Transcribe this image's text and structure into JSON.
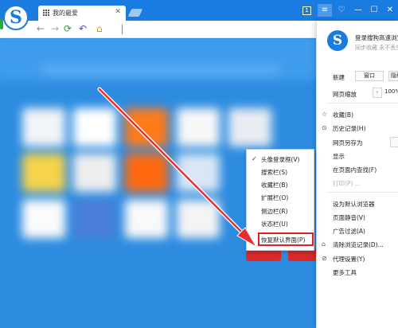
{
  "browser": {
    "tab_title": "我的最爱",
    "tab_close": "✕",
    "badge_count": "1",
    "window_controls": {
      "menu": "≡",
      "skin": "♡",
      "minimize": "—",
      "maximize": "☐",
      "close": "✕"
    },
    "logo_letter": "S"
  },
  "toolbar": {
    "back": "←",
    "forward": "→",
    "refresh": "⟳",
    "undo": "↶",
    "home": "⌂"
  },
  "panel": {
    "logo_letter": "S",
    "login_text": "登录搜狗高速浏览器",
    "sync_text": "同步收藏 永不丢失",
    "new_label": "新建",
    "new_window": "窗口",
    "new_incognito": "隐私窗口",
    "zoom_label": "网页缩放",
    "zoom_minus": "-",
    "zoom_value": "100%",
    "items_top": [
      {
        "label": "收藏(B)",
        "icon": "☆"
      },
      {
        "label": "历史记录(H)",
        "icon": "⊙"
      },
      {
        "label": "网页另存为",
        "icon": ""
      },
      {
        "label": "显示",
        "icon": ""
      },
      {
        "label": "在页面内查找(F)",
        "icon": ""
      },
      {
        "label": "打印(P) ...",
        "icon": ""
      }
    ],
    "items_bottom": [
      {
        "label": "设为默认浏览器",
        "icon": ""
      },
      {
        "label": "页面静音(V)",
        "icon": ""
      },
      {
        "label": "广告过滤(A)",
        "icon": ""
      },
      {
        "label": "清除浏览记录(D)...",
        "icon": "⌂"
      },
      {
        "label": "代理设置(Y)",
        "icon": "⊘"
      },
      {
        "label": "更多工具",
        "icon": ""
      }
    ]
  },
  "context_menu": {
    "items": [
      {
        "label": "头像登录框(V)",
        "checked": true
      },
      {
        "label": "搜索栏(S)"
      },
      {
        "label": "收藏栏(B)"
      },
      {
        "label": "扩展栏(O)"
      },
      {
        "label": "侧边栏(R)"
      },
      {
        "label": "状态栏(U)"
      },
      {
        "label": "恢复默认界面(P)"
      }
    ],
    "check_mark": "✓"
  },
  "colors": {
    "brand_blue": "#1a7be0",
    "page_blue": "#2e8ce0",
    "highlight_red": "#e02020",
    "arrow_red": "#e53030"
  }
}
